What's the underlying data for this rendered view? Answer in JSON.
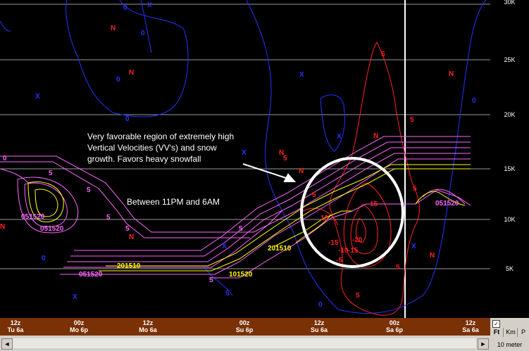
{
  "y_axis": {
    "labels": [
      "30K",
      "25K",
      "20K",
      "15K",
      "10K",
      "5K"
    ]
  },
  "time_axis": {
    "ticks": [
      {
        "top": "12z",
        "bottom": "Tu 6a"
      },
      {
        "top": "00z",
        "bottom": "Mo 6p"
      },
      {
        "top": "12z",
        "bottom": "Mo 6a"
      },
      {
        "top": "00z",
        "bottom": "Su 6p"
      },
      {
        "top": "12z",
        "bottom": "Su 6a"
      },
      {
        "top": "00z",
        "bottom": "Sa 6p"
      },
      {
        "top": "12z",
        "bottom": "Sa 6a"
      }
    ]
  },
  "annotations": {
    "main_line1": "Very favorable region of extremely high",
    "main_line2": "Vertical Velocities (VV's) and snow",
    "main_line3": "growth.  Favors heavy snowfall",
    "time_window": "Between 11PM and 6AM"
  },
  "controls": {
    "checkbox": "✓",
    "units": [
      "Ft",
      "Km",
      "P"
    ],
    "height_label": "10 meter"
  },
  "scrollbar": {
    "left_arrow": "◄",
    "right_arrow": "►"
  },
  "colors": {
    "rh_contours": "#ff66ff",
    "vv_contours": "#ffff00",
    "temp_contours": "#2233ff",
    "omega_contours": "#ff2222",
    "axis_bg": "#7a3106"
  },
  "contour_labels": {
    "n": "N",
    "x": "X",
    "zero": "0",
    "five": "5",
    "rh_left": "051520",
    "rh_mid": "201510",
    "rh_right": "051520",
    "rh_low": "101520",
    "rh_bottom": "051520",
    "rh_bottom2": "201510",
    "neg15": "-15",
    "neg20": "-20",
    "neg10": "-10",
    "neg5": "-5",
    "pos10": "10",
    "pos15": "15"
  }
}
